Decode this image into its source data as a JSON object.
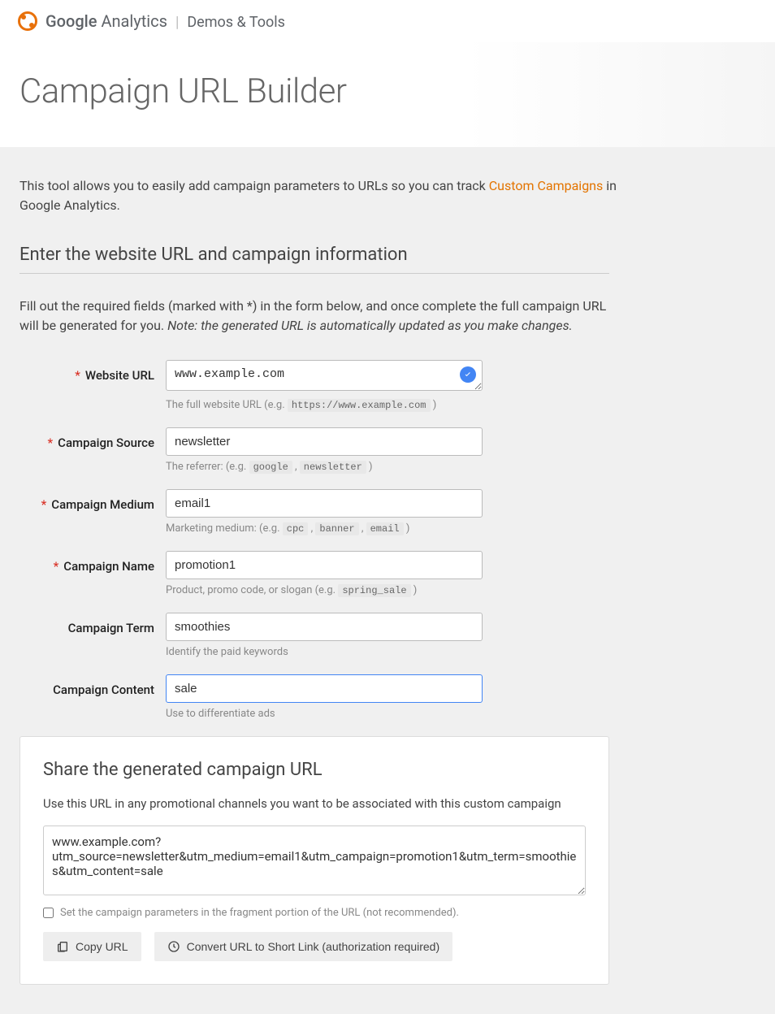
{
  "header": {
    "brand_google": "Google",
    "brand_analytics": "Analytics",
    "brand_tools": "Demos & Tools"
  },
  "title": "Campaign URL Builder",
  "intro": {
    "pre": "This tool allows you to easily add campaign parameters to URLs so you can track ",
    "link": "Custom Campaigns",
    "post": " in Google Analytics."
  },
  "section_head": "Enter the website URL and campaign information",
  "fill_text": "Fill out the required fields (marked with *) in the form below, and once complete the full campaign URL will be generated for you. ",
  "fill_note": "Note: the generated URL is automatically updated as you make changes.",
  "fields": {
    "website_url": {
      "label": "Website URL",
      "value": "www.example.com",
      "hint_pre": "The full website URL (e.g. ",
      "hint_code": "https://www.example.com",
      "hint_post": " )"
    },
    "source": {
      "label": "Campaign Source",
      "value": "newsletter",
      "hint_pre": "The referrer: (e.g. ",
      "hint_code1": "google",
      "hint_sep": " , ",
      "hint_code2": "newsletter",
      "hint_post": " )"
    },
    "medium": {
      "label": "Campaign Medium",
      "value": "email1",
      "hint_pre": "Marketing medium: (e.g. ",
      "hint_code1": "cpc",
      "hint_sep1": " , ",
      "hint_code2": "banner",
      "hint_sep2": " , ",
      "hint_code3": "email",
      "hint_post": " )"
    },
    "name": {
      "label": "Campaign Name",
      "value": "promotion1",
      "hint_pre": "Product, promo code, or slogan (e.g. ",
      "hint_code": "spring_sale",
      "hint_post": " )"
    },
    "term": {
      "label": "Campaign Term",
      "value": "smoothies",
      "hint": "Identify the paid keywords"
    },
    "content": {
      "label": "Campaign Content",
      "value": "sale",
      "hint": "Use to differentiate ads"
    }
  },
  "share": {
    "title": "Share the generated campaign URL",
    "desc": "Use this URL in any promotional channels you want to be associated with this custom campaign",
    "url": "www.example.com?utm_source=newsletter&utm_medium=email1&utm_campaign=promotion1&utm_term=smoothies&utm_content=sale",
    "fragment_label": "Set the campaign parameters in the fragment portion of the URL (not recommended).",
    "copy_btn": "Copy URL",
    "convert_btn": "Convert URL to Short Link (authorization required)"
  }
}
